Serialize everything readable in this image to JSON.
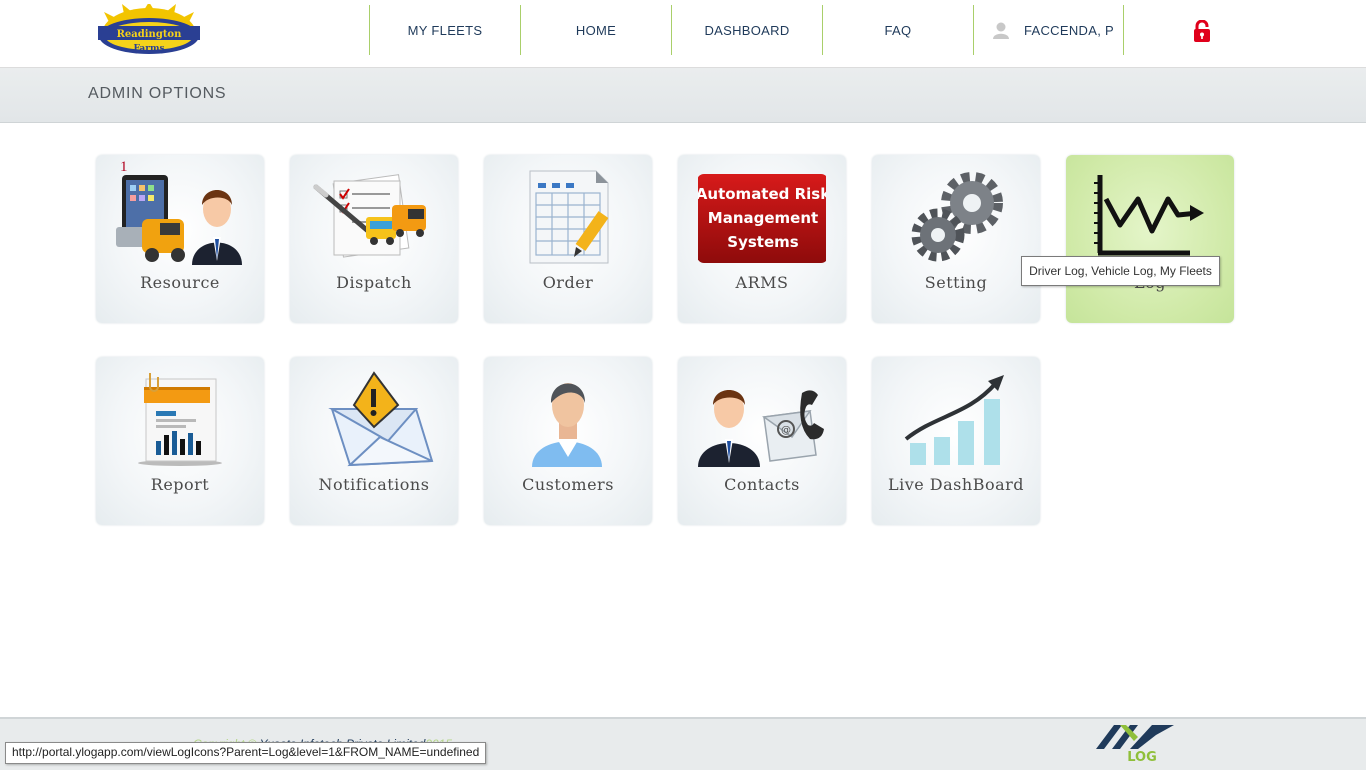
{
  "header": {
    "logo_text_top": "Readington",
    "logo_text_bottom": "Farms",
    "nav": [
      {
        "label": "MY FLEETS"
      },
      {
        "label": "HOME"
      },
      {
        "label": "DASHBOARD"
      },
      {
        "label": "FAQ"
      }
    ],
    "user": {
      "name": "FACCENDA, P"
    },
    "colors": {
      "nav_divider": "#a9cf6a",
      "nav_text": "#1f3a5a",
      "lock": "#e0001b"
    }
  },
  "page_title": "ADMIN OPTIONS",
  "tiles": [
    {
      "label": "Resource",
      "icon": "resource-icon",
      "badge": "1"
    },
    {
      "label": "Dispatch",
      "icon": "dispatch-icon"
    },
    {
      "label": "Order",
      "icon": "order-icon"
    },
    {
      "label": "ARMS",
      "icon": "arms-icon",
      "icon_text": [
        "Automated Risk",
        "Management",
        "Systems"
      ]
    },
    {
      "label": "Setting",
      "icon": "gears-icon"
    },
    {
      "label": "Log",
      "icon": "log-chart-icon",
      "active": true
    },
    {
      "label": "Report",
      "icon": "report-icon"
    },
    {
      "label": "Notifications",
      "icon": "notification-envelope-icon"
    },
    {
      "label": "Customers",
      "icon": "customer-icon"
    },
    {
      "label": "Contacts",
      "icon": "contacts-icon"
    },
    {
      "label": "Live DashBoard",
      "icon": "growth-chart-icon"
    }
  ],
  "tooltip": "Driver Log, Vehicle Log, My Fleets",
  "footer": {
    "copyright_prefix": "Copyright ©",
    "company": "Yusata Infotech Private Limited",
    "year": "2015",
    "brand_logo": "ylog-logo"
  },
  "status_url": "http://portal.ylogapp.com/viewLogIcons?Parent=Log&level=1&FROM_NAME=undefined"
}
